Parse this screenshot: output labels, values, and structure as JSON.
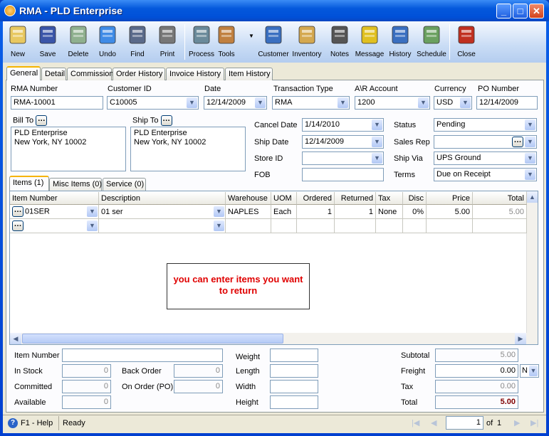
{
  "window": {
    "title": "RMA - PLD Enterprise",
    "minimize": "_",
    "maximize": "□",
    "close": "✕"
  },
  "toolbar": [
    {
      "label": "New",
      "icon": "new-document-icon"
    },
    {
      "label": "Save",
      "icon": "floppy-disk-icon"
    },
    {
      "label": "Delete",
      "icon": "recycle-bin-icon"
    },
    {
      "label": "Undo",
      "icon": "undo-arrow-icon"
    },
    {
      "label": "Find",
      "icon": "binoculars-icon"
    },
    {
      "label": "Print",
      "icon": "printer-icon"
    },
    {
      "label": "Process",
      "icon": "process-gear-icon"
    },
    {
      "label": "Tools",
      "icon": "tools-icon"
    },
    {
      "label": "Customer",
      "icon": "customer-person-icon"
    },
    {
      "label": "Inventory",
      "icon": "boxes-icon"
    },
    {
      "label": "Notes",
      "icon": "notepad-icon"
    },
    {
      "label": "Message",
      "icon": "message-icon"
    },
    {
      "label": "History",
      "icon": "history-person-hourglass-icon"
    },
    {
      "label": "Schedule",
      "icon": "schedule-calendar-icon"
    },
    {
      "label": "Close",
      "icon": "close-window-icon"
    }
  ],
  "tabs": [
    "General",
    "Detail",
    "Commission",
    "Order History",
    "Invoice History",
    "Item History"
  ],
  "header": {
    "rma_number": {
      "label": "RMA Number",
      "value": "RMA-10001"
    },
    "customer_id": {
      "label": "Customer ID",
      "value": "C10005"
    },
    "date": {
      "label": "Date",
      "value": "12/14/2009"
    },
    "transaction_type": {
      "label": "Transaction Type",
      "value": "RMA"
    },
    "ar_account": {
      "label": "A\\R Account",
      "value": "1200"
    },
    "currency": {
      "label": "Currency",
      "value": "USD"
    },
    "po_number": {
      "label": "PO Number",
      "value": "12/14/2009"
    }
  },
  "bill_to": {
    "label": "Bill To",
    "line1": "PLD Enterprise",
    "line2": "New York, NY 10002"
  },
  "ship_to": {
    "label": "Ship To",
    "line1": "PLD Enterprise",
    "line2": "New York, NY 10002"
  },
  "fields": {
    "cancel_date": {
      "label": "Cancel Date",
      "value": "1/14/2010"
    },
    "ship_date": {
      "label": "Ship Date",
      "value": "12/14/2009"
    },
    "store_id": {
      "label": "Store ID",
      "value": ""
    },
    "fob": {
      "label": "FOB",
      "value": ""
    },
    "status": {
      "label": "Status",
      "value": "Pending"
    },
    "sales_rep": {
      "label": "Sales Rep",
      "value": ""
    },
    "ship_via": {
      "label": "Ship Via",
      "value": "UPS Ground"
    },
    "terms": {
      "label": "Terms",
      "value": "Due on Receipt"
    }
  },
  "subtabs": [
    "Items (1)",
    "Misc Items (0)",
    "Service (0)"
  ],
  "grid": {
    "columns": [
      "Item Number",
      "Description",
      "Warehouse",
      "UOM",
      "Ordered",
      "Returned",
      "Tax",
      "Disc",
      "Price",
      "Total"
    ],
    "rows": [
      [
        "01SER",
        "01 ser",
        "NAPLES",
        "Each",
        "1",
        "1",
        "None",
        "0%",
        "5.00",
        "5.00"
      ]
    ]
  },
  "callout": "you can enter items you want to return",
  "bottom": {
    "item_number": {
      "label": "Item Number",
      "value": ""
    },
    "in_stock": {
      "label": "In Stock",
      "value": "0"
    },
    "committed": {
      "label": "Committed",
      "value": "0"
    },
    "available": {
      "label": "Available",
      "value": "0"
    },
    "back_order": {
      "label": "Back Order",
      "value": "0"
    },
    "on_order": {
      "label": "On Order (PO)",
      "value": "0"
    },
    "weight": {
      "label": "Weight",
      "value": ""
    },
    "length": {
      "label": "Length",
      "value": ""
    },
    "width": {
      "label": "Width",
      "value": ""
    },
    "height": {
      "label": "Height",
      "value": ""
    },
    "subtotal": {
      "label": "Subtotal",
      "value": "5.00"
    },
    "freight": {
      "label": "Freight",
      "value": "0.00",
      "option": "N"
    },
    "tax": {
      "label": "Tax",
      "value": "0.00"
    },
    "total": {
      "label": "Total",
      "value": "5.00"
    }
  },
  "statusbar": {
    "help": "F1 - Help",
    "status": "Ready",
    "page": "1",
    "of_label": "of",
    "pages": "1"
  },
  "colors": {
    "accent": "#0054e3",
    "callout_text": "#e00000",
    "total_text": "#800000"
  }
}
